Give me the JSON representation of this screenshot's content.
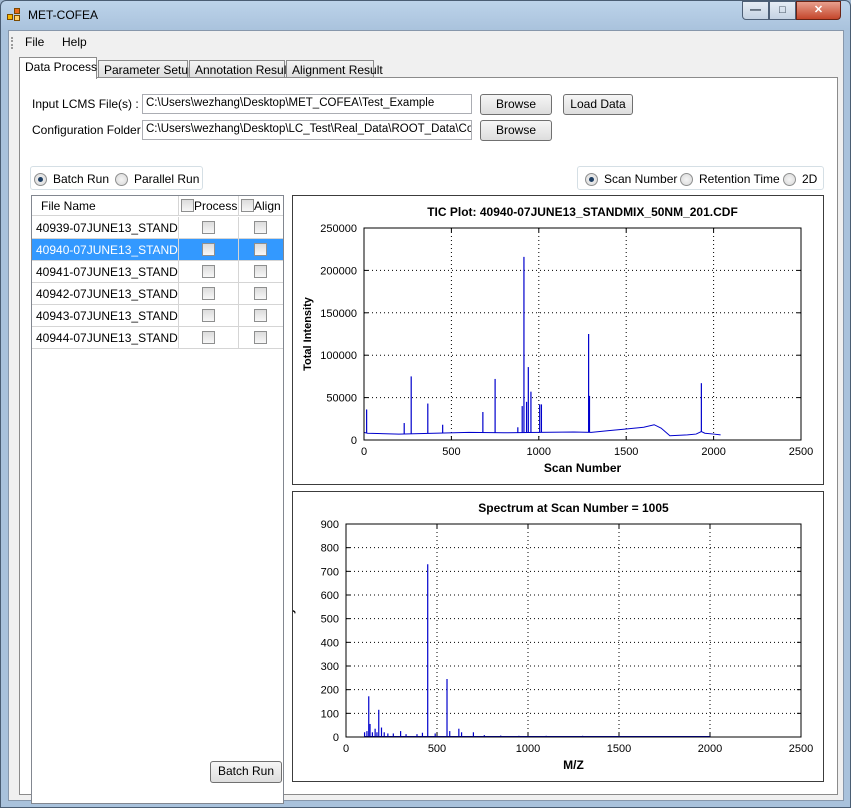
{
  "window": {
    "title": "MET-COFEA",
    "minimize": "—",
    "maximize": "□",
    "close": "✕"
  },
  "menu": {
    "file": "File",
    "help": "Help"
  },
  "tabs": [
    "Data Process",
    "Parameter Setup",
    "Annotation Result",
    "Alignment Result"
  ],
  "input": {
    "lcms_label": "Input LCMS File(s) :",
    "lcms_value": "C:\\Users\\wezhang\\Desktop\\MET_COFEA\\Test_Example",
    "config_label": "Configuration Folder :",
    "config_value": "C:\\Users\\wezhang\\Desktop\\LC_Test\\Real_Data\\ROOT_Data\\Con",
    "browse_label": "Browse",
    "load_label": "Load Data"
  },
  "run_mode": {
    "batch": "Batch Run",
    "parallel": "Parallel Run",
    "selected": "batch"
  },
  "axis_mode": {
    "scan": "Scan Number",
    "rt": "Retention Time",
    "two_d": "2D",
    "selected": "scan"
  },
  "files": {
    "columns": [
      "File Name",
      "Process",
      "Align"
    ],
    "rows": [
      "40939-07JUNE13_STAND...",
      "40940-07JUNE13_STAND...",
      "40941-07JUNE13_STAND...",
      "40942-07JUNE13_STAND...",
      "40943-07JUNE13_STAND...",
      "40944-07JUNE13_STAND..."
    ],
    "selected_index": 1
  },
  "batch_run_label": "Batch Run",
  "colors": {
    "series": "#0000cc",
    "selection": "#3399ff"
  },
  "chart_data": [
    {
      "type": "line",
      "title": "TIC Plot: 40940-07JUNE13_STANDMIX_50NM_201.CDF",
      "xlabel": "Scan Number",
      "ylabel": "Total Intensity",
      "xlim": [
        0,
        2500
      ],
      "ylim": [
        0,
        250000
      ],
      "xticks": [
        0,
        500,
        1000,
        1500,
        2000,
        2500
      ],
      "yticks": [
        0,
        50000,
        100000,
        150000,
        200000,
        250000
      ],
      "grid": true,
      "baseline": [
        [
          0,
          9000
        ],
        [
          20,
          8000
        ],
        [
          200,
          7000
        ],
        [
          400,
          8000
        ],
        [
          600,
          9000
        ],
        [
          800,
          8500
        ],
        [
          1000,
          9000
        ],
        [
          1200,
          9500
        ],
        [
          1300,
          9000
        ],
        [
          1400,
          11000
        ],
        [
          1500,
          13000
        ],
        [
          1600,
          15000
        ],
        [
          1660,
          18000
        ],
        [
          1700,
          14000
        ],
        [
          1750,
          5000
        ],
        [
          1850,
          6000
        ],
        [
          1900,
          7000
        ],
        [
          1930,
          10000
        ],
        [
          1950,
          8000
        ],
        [
          2000,
          7000
        ],
        [
          2040,
          6000
        ]
      ],
      "peaks": [
        [
          15,
          36000
        ],
        [
          230,
          20000
        ],
        [
          270,
          75000
        ],
        [
          365,
          43000
        ],
        [
          450,
          18000
        ],
        [
          680,
          33000
        ],
        [
          750,
          72000
        ],
        [
          880,
          15000
        ],
        [
          905,
          40000
        ],
        [
          915,
          216000
        ],
        [
          930,
          45000
        ],
        [
          940,
          86000
        ],
        [
          955,
          57000
        ],
        [
          1005,
          42000
        ],
        [
          1015,
          42000
        ],
        [
          1285,
          125000
        ],
        [
          1290,
          52000
        ],
        [
          1930,
          67000
        ]
      ]
    },
    {
      "type": "bar",
      "title": "Spectrum at Scan Number = 1005",
      "xlabel": "M/Z",
      "ylabel": "Intensity",
      "xlim": [
        0,
        2500
      ],
      "ylim": [
        0,
        900
      ],
      "xticks": [
        0,
        500,
        1000,
        1500,
        2000,
        2500
      ],
      "yticks": [
        0,
        100,
        200,
        300,
        400,
        500,
        600,
        700,
        800,
        900
      ],
      "grid": true,
      "peaks": [
        [
          102,
          20
        ],
        [
          115,
          25
        ],
        [
          125,
          172
        ],
        [
          132,
          55
        ],
        [
          145,
          20
        ],
        [
          160,
          35
        ],
        [
          170,
          20
        ],
        [
          180,
          115
        ],
        [
          195,
          40
        ],
        [
          210,
          20
        ],
        [
          230,
          15
        ],
        [
          260,
          15
        ],
        [
          300,
          25
        ],
        [
          330,
          12
        ],
        [
          390,
          12
        ],
        [
          420,
          18
        ],
        [
          449,
          730
        ],
        [
          490,
          15
        ],
        [
          555,
          245
        ],
        [
          570,
          25
        ],
        [
          620,
          35
        ],
        [
          635,
          20
        ],
        [
          700,
          20
        ],
        [
          760,
          8
        ],
        [
          850,
          6
        ],
        [
          950,
          5
        ],
        [
          1100,
          5
        ],
        [
          1300,
          5
        ],
        [
          1500,
          4
        ],
        [
          1700,
          4
        ],
        [
          1900,
          4
        ],
        [
          2000,
          3
        ]
      ]
    }
  ]
}
